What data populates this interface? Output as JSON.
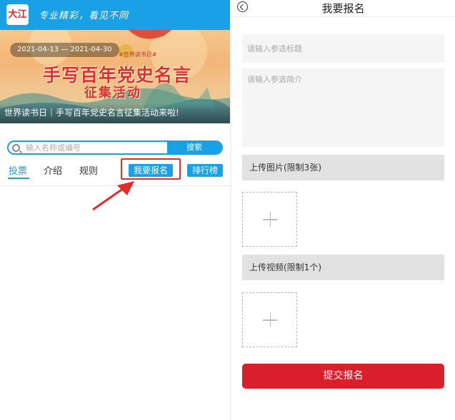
{
  "left_panel": {
    "header": {
      "logo_text": "大江",
      "slogan": "专业精彩，看见不同"
    },
    "banner": {
      "date_range": "2021-04-13 — 2021-04-30",
      "tag": "#世界读书日#",
      "headline": "手写百年党史名言",
      "subheadline": "征集活动",
      "caption": "世界读书日｜手写百年党史名言征集活动来啦!"
    },
    "search": {
      "placeholder": "输入名称或编号",
      "button_label": "搜索"
    },
    "tabs": [
      {
        "label": "投票",
        "active": true
      },
      {
        "label": "介绍",
        "active": false
      },
      {
        "label": "规则",
        "active": false
      }
    ],
    "signup_button_label": "我要报名",
    "ranking_button_label": "排行榜",
    "colors": {
      "accent": "#1aa0e4",
      "highlight": "#e32c2c"
    }
  },
  "right_panel": {
    "title": "我要报名",
    "title_field_placeholder": "请输入参选标题",
    "intro_field_placeholder": "请输入参选简介",
    "image_section_label": "上传图片(限制3张)",
    "video_section_label": "上传视频(限制1个)",
    "submit_label": "提交报名",
    "colors": {
      "submit": "#d91f2b",
      "section_bar": "#e2e2e2",
      "field_bg": "#f5f5f5"
    }
  }
}
